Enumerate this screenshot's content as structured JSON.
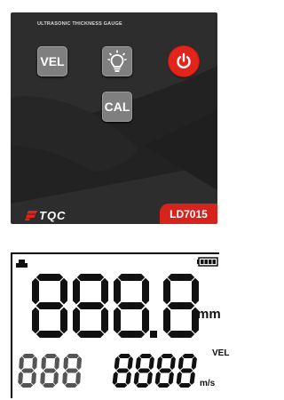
{
  "panel": {
    "title": "ULTRASONIC THICKNESS GAUGE",
    "buttons": {
      "vel_label": "VEL",
      "light_icon": "lightbulb-icon",
      "power_icon": "power-icon",
      "cal_label": "CAL"
    },
    "brand": "TQC",
    "brand_icon": "tqc-logo-icon",
    "model": "LD7015",
    "colors": {
      "panel": "#2d2d2d",
      "key": "#7f7f7f",
      "power": "#e1251b",
      "badge": "#d6241c"
    }
  },
  "lcd": {
    "main_digits": "888.8",
    "unit_main": "mm",
    "velocity_indicator": "VEL",
    "small_left_digits": "888",
    "velocity_digits": "8888",
    "unit_velocity": "m/s",
    "icons": [
      "probe-icon",
      "battery-icon"
    ]
  }
}
